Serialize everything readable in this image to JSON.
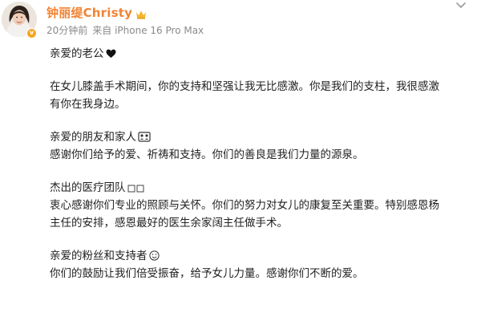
{
  "author": {
    "name": "钟丽缇Christy",
    "time": "20分钟前",
    "source": "来自 iPhone 16 Pro Max",
    "accent_color": "#f28433",
    "badge_icon": "crown-icon",
    "verified_icon": "verified-v-icon"
  },
  "post": {
    "greeting_husband": "亲爱的老公",
    "husband_text": "在女儿膝盖手术期间，你的支持和坚强让我无比感激。你是我们的支柱，我很感激",
    "husband_text_2": "有你在我身边。",
    "friends_title": "亲爱的朋友和家人",
    "friends_text": "感谢你们给予的爱、祈祷和支持。你们的善良是我们力量的源泉。",
    "medical_title": "杰出的医疗团队",
    "medical_text": "衷心感谢你们专业的照顾与关怀。你们的努力对女儿的康复至关重要。特别感恩杨",
    "medical_text_2": "主任的安排，感恩最好的医生余家阔主任做手术。",
    "fans_title": "亲爱的粉丝和支持者",
    "fans_text": "你们的鼓励让我们倍受振奋，给予女儿力量。感谢你们不断的爱。"
  },
  "icons": {
    "heart": "black-heart-icon",
    "family": "family-emoji-icon",
    "medical": "hospital-emoji-icon",
    "fans": "smile-emoji-icon",
    "more": "chevron-down-icon"
  }
}
